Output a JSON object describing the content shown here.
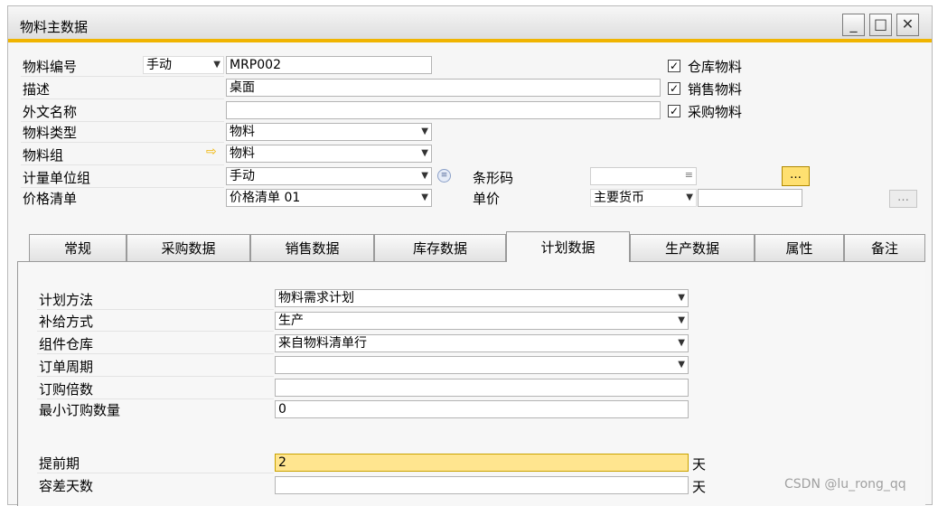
{
  "window": {
    "title": "物料主数据",
    "minimize_label": "_",
    "maximize_label": "□",
    "close_label": "✕"
  },
  "header": {
    "item_code_label": "物料编号",
    "numbering_mode": "手动",
    "item_code_value": "MRP002",
    "description_label": "描述",
    "description_value": "桌面",
    "foreign_name_label": "外文名称",
    "foreign_name_value": "",
    "item_type_label": "物料类型",
    "item_type_value": "物料",
    "item_group_label": "物料组",
    "item_group_value": "物料",
    "uom_group_label": "计量单位组",
    "uom_group_value": "手动",
    "price_list_label": "价格清单",
    "price_list_value": "价格清单 01",
    "barcode_label": "条形码",
    "barcode_value": "",
    "unit_price_label": "单价",
    "currency_value": "主要货币",
    "unit_price_value": "",
    "more_button_label": "…",
    "inventory_item_label": "仓库物料",
    "sales_item_label": "销售物料",
    "purchase_item_label": "采购物料",
    "inventory_item_checked": true,
    "sales_item_checked": true,
    "purchase_item_checked": true
  },
  "tabs": [
    {
      "label": "常规"
    },
    {
      "label": "采购数据"
    },
    {
      "label": "销售数据"
    },
    {
      "label": "库存数据"
    },
    {
      "label": "计划数据"
    },
    {
      "label": "生产数据"
    },
    {
      "label": "属性"
    },
    {
      "label": "备注"
    }
  ],
  "planning": {
    "method_label": "计划方法",
    "method_value": "物料需求计划",
    "procurement_label": "补给方式",
    "procurement_value": "生产",
    "component_wh_label": "组件仓库",
    "component_wh_value": "来自物料清单行",
    "order_interval_label": "订单周期",
    "order_interval_value": "",
    "order_multiple_label": "订购倍数",
    "order_multiple_value": "",
    "min_order_qty_label": "最小订购数量",
    "min_order_qty_value": "0",
    "lead_time_label": "提前期",
    "lead_time_value": "2",
    "tolerance_days_label": "容差天数",
    "tolerance_days_value": "",
    "days_unit": "天"
  },
  "watermark": "CSDN @lu_rong_qq",
  "colors": {
    "accent": "#f0b400",
    "highlight_field": "#ffe58f",
    "arrow": "#f0b400"
  }
}
